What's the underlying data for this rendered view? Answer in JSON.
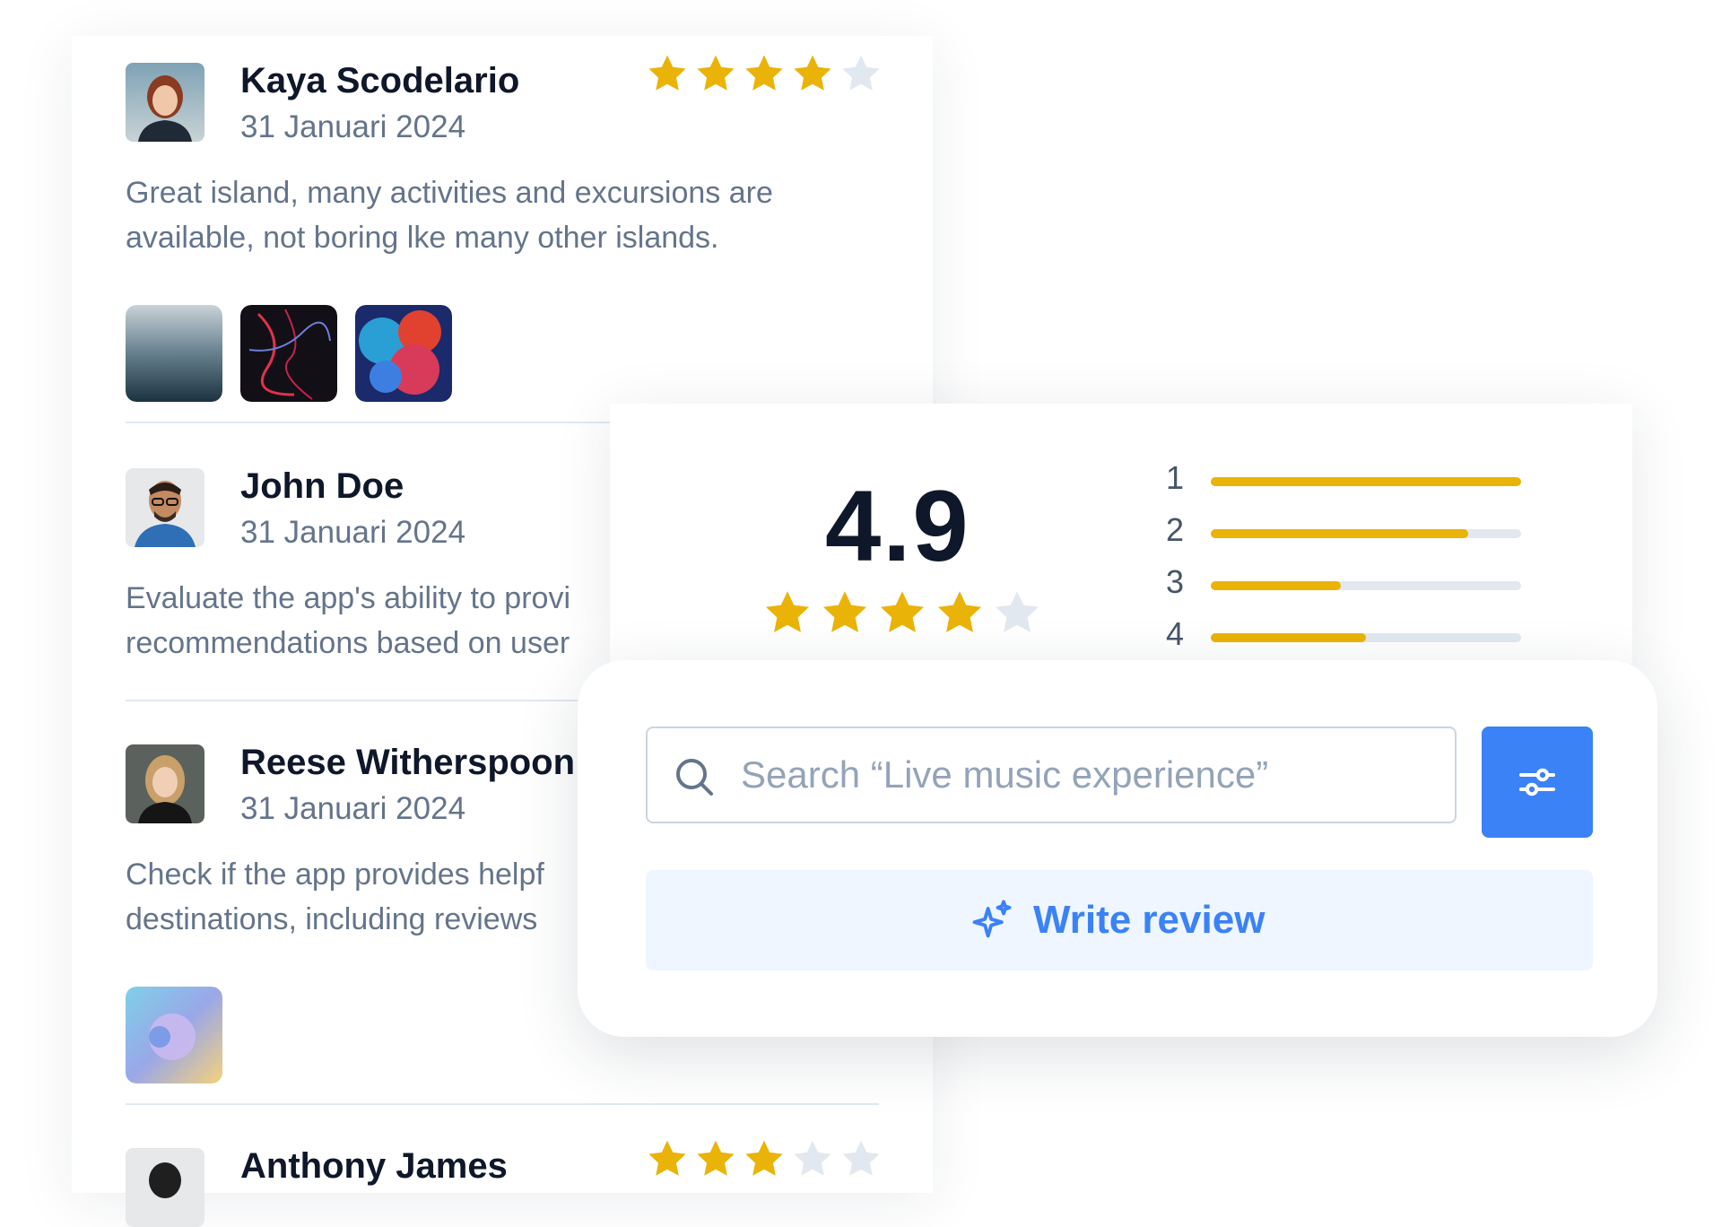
{
  "reviews": [
    {
      "name": "Kaya Scodelario",
      "date": "31 Januari 2024",
      "rating": 4,
      "text": "Great island, many activities and excursions are available, not boring lke many other islands.",
      "photo_count": 3
    },
    {
      "name": "John Doe",
      "date": "31 Januari 2024",
      "text": "Evaluate the app's ability to provi recommendations based on user"
    },
    {
      "name": "Reese Witherspoon",
      "date": "31 Januari 2024",
      "text": "Check if the app provides helpf destinations, including reviews",
      "photo_count": 1
    },
    {
      "name": "Anthony James",
      "rating": 3
    }
  ],
  "summary": {
    "score": "4.9",
    "rating": 4,
    "breakdown": [
      {
        "label": "1",
        "fraction": 1.0
      },
      {
        "label": "2",
        "fraction": 0.83
      },
      {
        "label": "3",
        "fraction": 0.42
      },
      {
        "label": "4",
        "fraction": 0.5
      }
    ]
  },
  "search": {
    "placeholder": "Search “Live music experience”"
  },
  "write_review": {
    "label": "Write review"
  },
  "colors": {
    "star_filled": "#EAB308",
    "star_empty": "#E2E8F0",
    "accent": "#3B82F6",
    "accent_soft": "#EFF6FF"
  },
  "icons": [
    "search-icon",
    "filter-sliders-icon",
    "sparkle-icon",
    "star-icon"
  ]
}
